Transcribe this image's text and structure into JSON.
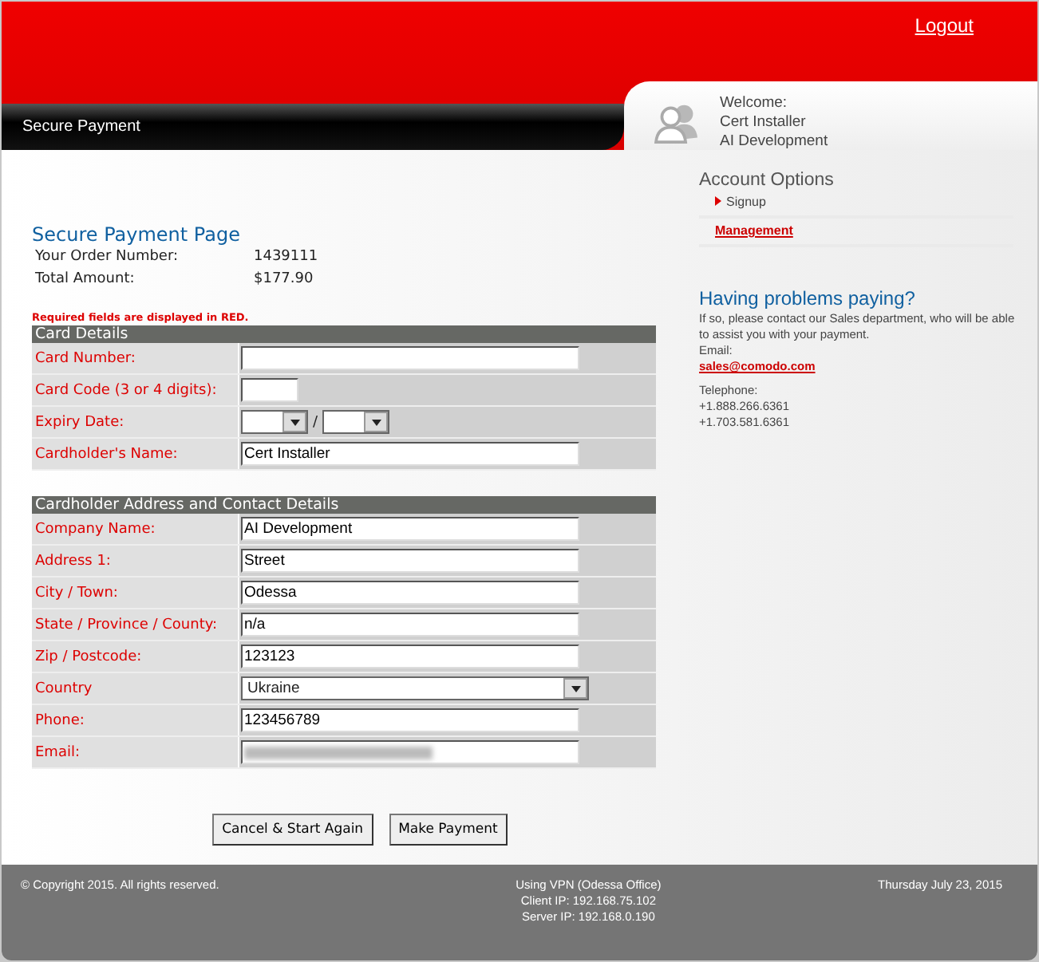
{
  "header": {
    "logout": "Logout",
    "title": "Secure Payment",
    "welcome": "Welcome:",
    "user": "Cert Installer",
    "company": "AI Development"
  },
  "order": {
    "heading": "Secure Payment Page",
    "fields": [
      {
        "label": "Your Order Number:",
        "value": "1439111"
      },
      {
        "label": "Total Amount:",
        "value": "$177.90"
      }
    ]
  },
  "required_note": "Required fields are displayed in RED.",
  "sections": [
    {
      "title": "Card Details",
      "rows": [
        {
          "label": "Card Number:",
          "required": true,
          "kind": "text"
        },
        {
          "label": "Card Code (3 or 4 digits):",
          "required": true,
          "kind": "code"
        },
        {
          "label": "Expiry Date:",
          "required": true,
          "kind": "expiry",
          "separator": "/"
        },
        {
          "label": "Cardholder's Name:",
          "required": true,
          "kind": "text",
          "value": "Cert Installer"
        }
      ]
    },
    {
      "title": "Cardholder Address and Contact Details",
      "rows": [
        {
          "label": "Company Name:",
          "required": true,
          "kind": "text",
          "value": "AI Development"
        },
        {
          "label": "Address 1:",
          "required": true,
          "kind": "text",
          "value": "Street"
        },
        {
          "label": "City / Town:",
          "required": true,
          "kind": "text",
          "value": "Odessa"
        },
        {
          "label": "State / Province / County:",
          "required": true,
          "kind": "text",
          "value": "n/a"
        },
        {
          "label": "Zip / Postcode:",
          "required": true,
          "kind": "text",
          "value": "123123"
        },
        {
          "label": "Country",
          "required": true,
          "kind": "select",
          "value": "Ukraine"
        },
        {
          "label": "Phone:",
          "required": true,
          "kind": "text",
          "value": "123456789"
        },
        {
          "label": "Email:",
          "required": true,
          "kind": "blurred"
        }
      ]
    }
  ],
  "buttons": [
    "Cancel & Start Again",
    "Make Payment"
  ],
  "account_options": {
    "title": "Account Options",
    "items": [
      {
        "label": "Signup",
        "kind": "arrow"
      },
      {
        "label": "Management",
        "kind": "link"
      }
    ]
  },
  "help": {
    "title": "Having problems paying?",
    "text": "If so, please contact our Sales department, who will be able to assist you with your payment.",
    "email_label": "Email:",
    "email": "sales@comodo.com",
    "phone_label": "Telephone:",
    "phones": [
      "+1.888.266.6361",
      "+1.703.581.6361"
    ]
  },
  "footer": {
    "copyright": "© Copyright 2015. All rights reserved.",
    "vpn": [
      "Using VPN (Odessa Office)",
      "Client IP: 192.168.75.102",
      "Server IP: 192.168.0.190"
    ],
    "date": "Thursday July 23, 2015"
  }
}
